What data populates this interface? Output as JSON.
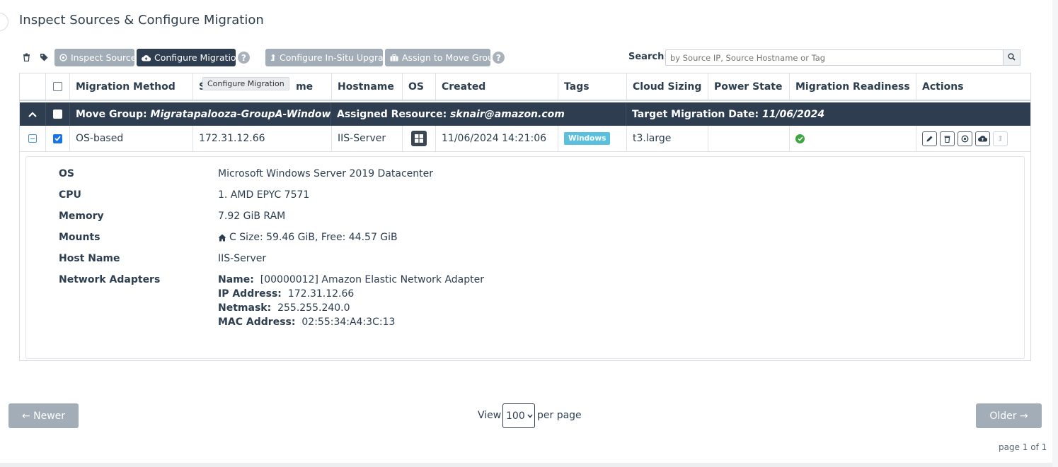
{
  "page": {
    "title": "Inspect Sources & Configure Migration"
  },
  "toolbar": {
    "trash_icon": "trash-icon",
    "tag_icon": "tag-icon",
    "inspect_label": "Inspect Sources",
    "configure_label": "Configure Migration",
    "insitu_label": "Configure In-Situ Upgrade",
    "assign_label": "Assign to Move Group",
    "help": "?",
    "search_label": "Search:",
    "search_placeholder": "by Source IP, Source Hostname or Tag"
  },
  "tooltip": "Configure Migration",
  "table": {
    "headers": [
      "Migration Method",
      "Source IP/Hostname",
      "Hostname",
      "OS",
      "Created",
      "Tags",
      "Cloud Sizing",
      "Power State",
      "Migration Readiness",
      "Actions"
    ],
    "header_visible": {
      "source_prefix": "S",
      "source_suffix": "me"
    },
    "group": {
      "move_group_label": "Move Group:",
      "move_group_name": "Migratapalooza-GroupA-Windows",
      "assigned_label": "Assigned Resource:",
      "assigned_value": "sknair@amazon.com",
      "target_label": "Target Migration Date:",
      "target_value": "11/06/2024"
    },
    "row": {
      "method": "OS-based",
      "source_ip": "172.31.12.66",
      "hostname": "IIS-Server",
      "os_icon": "windows-icon",
      "created": "11/06/2024 14:21:06",
      "tag": "Windows",
      "cloud_sizing": "t3.large",
      "power_state": "",
      "readiness": "ready",
      "checked": true
    }
  },
  "details": {
    "os_label": "OS",
    "os_value": "Microsoft Windows Server 2019 Datacenter",
    "cpu_label": "CPU",
    "cpu_value": "1. AMD EPYC 7571",
    "memory_label": "Memory",
    "memory_value": "7.92 GiB RAM",
    "mounts_label": "Mounts",
    "mounts_value": "C Size: 59.46 GiB, Free: 44.57 GiB",
    "hostname_label": "Host Name",
    "hostname_value": "IIS-Server",
    "network_label": "Network Adapters",
    "adapter_name_label": "Name:",
    "adapter_name": "[00000012] Amazon Elastic Network Adapter",
    "ip_label": "IP Address:",
    "ip_value": "172.31.12.66",
    "netmask_label": "Netmask:",
    "netmask_value": "255.255.240.0",
    "mac_label": "MAC Address:",
    "mac_value": "02:55:34:A4:3C:13"
  },
  "pagination": {
    "newer": "← Newer",
    "older": "Older →",
    "view": "View",
    "per_page_value": "100",
    "per_page": "per page",
    "page_info": "page 1 of 1"
  },
  "colors": {
    "dark": "#2e3e50",
    "grey_button": "#a3adb8",
    "tag": "#5bc0de",
    "ok": "#3da640"
  }
}
